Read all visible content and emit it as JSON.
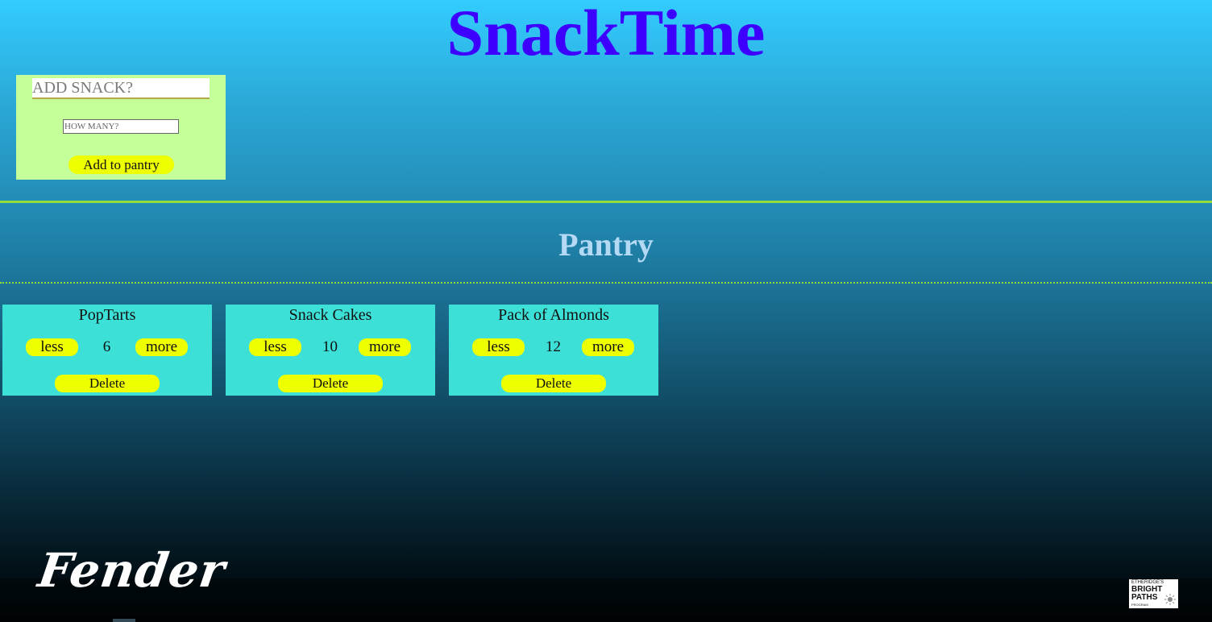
{
  "app": {
    "title": "SnackTime"
  },
  "add_form": {
    "name_placeholder": "ADD SNACK?",
    "quantity_placeholder": "HOW MANY?",
    "submit_label": "Add to pantry"
  },
  "pantry": {
    "heading": "Pantry",
    "items": [
      {
        "name": "PopTarts",
        "count": "6",
        "less_label": "less",
        "more_label": "more",
        "delete_label": "Delete"
      },
      {
        "name": "Snack Cakes",
        "count": "10",
        "less_label": "less",
        "more_label": "more",
        "delete_label": "Delete"
      },
      {
        "name": "Pack of Almonds",
        "count": "12",
        "less_label": "less",
        "more_label": "more",
        "delete_label": "Delete"
      }
    ]
  },
  "footer": {
    "logo_text": "Fender",
    "badge": {
      "top_text": "ETHERIDGE'S",
      "main_text": "BRIGHT PATHS",
      "bottom_text": "PROGRAM"
    }
  },
  "colors": {
    "title": "#3d00ff",
    "form_panel": "#c4ff99",
    "pill_button": "#eeff00",
    "card": "#3de0d6",
    "divider": "#8fdc3a",
    "pantry_heading": "#b3d9f5"
  }
}
